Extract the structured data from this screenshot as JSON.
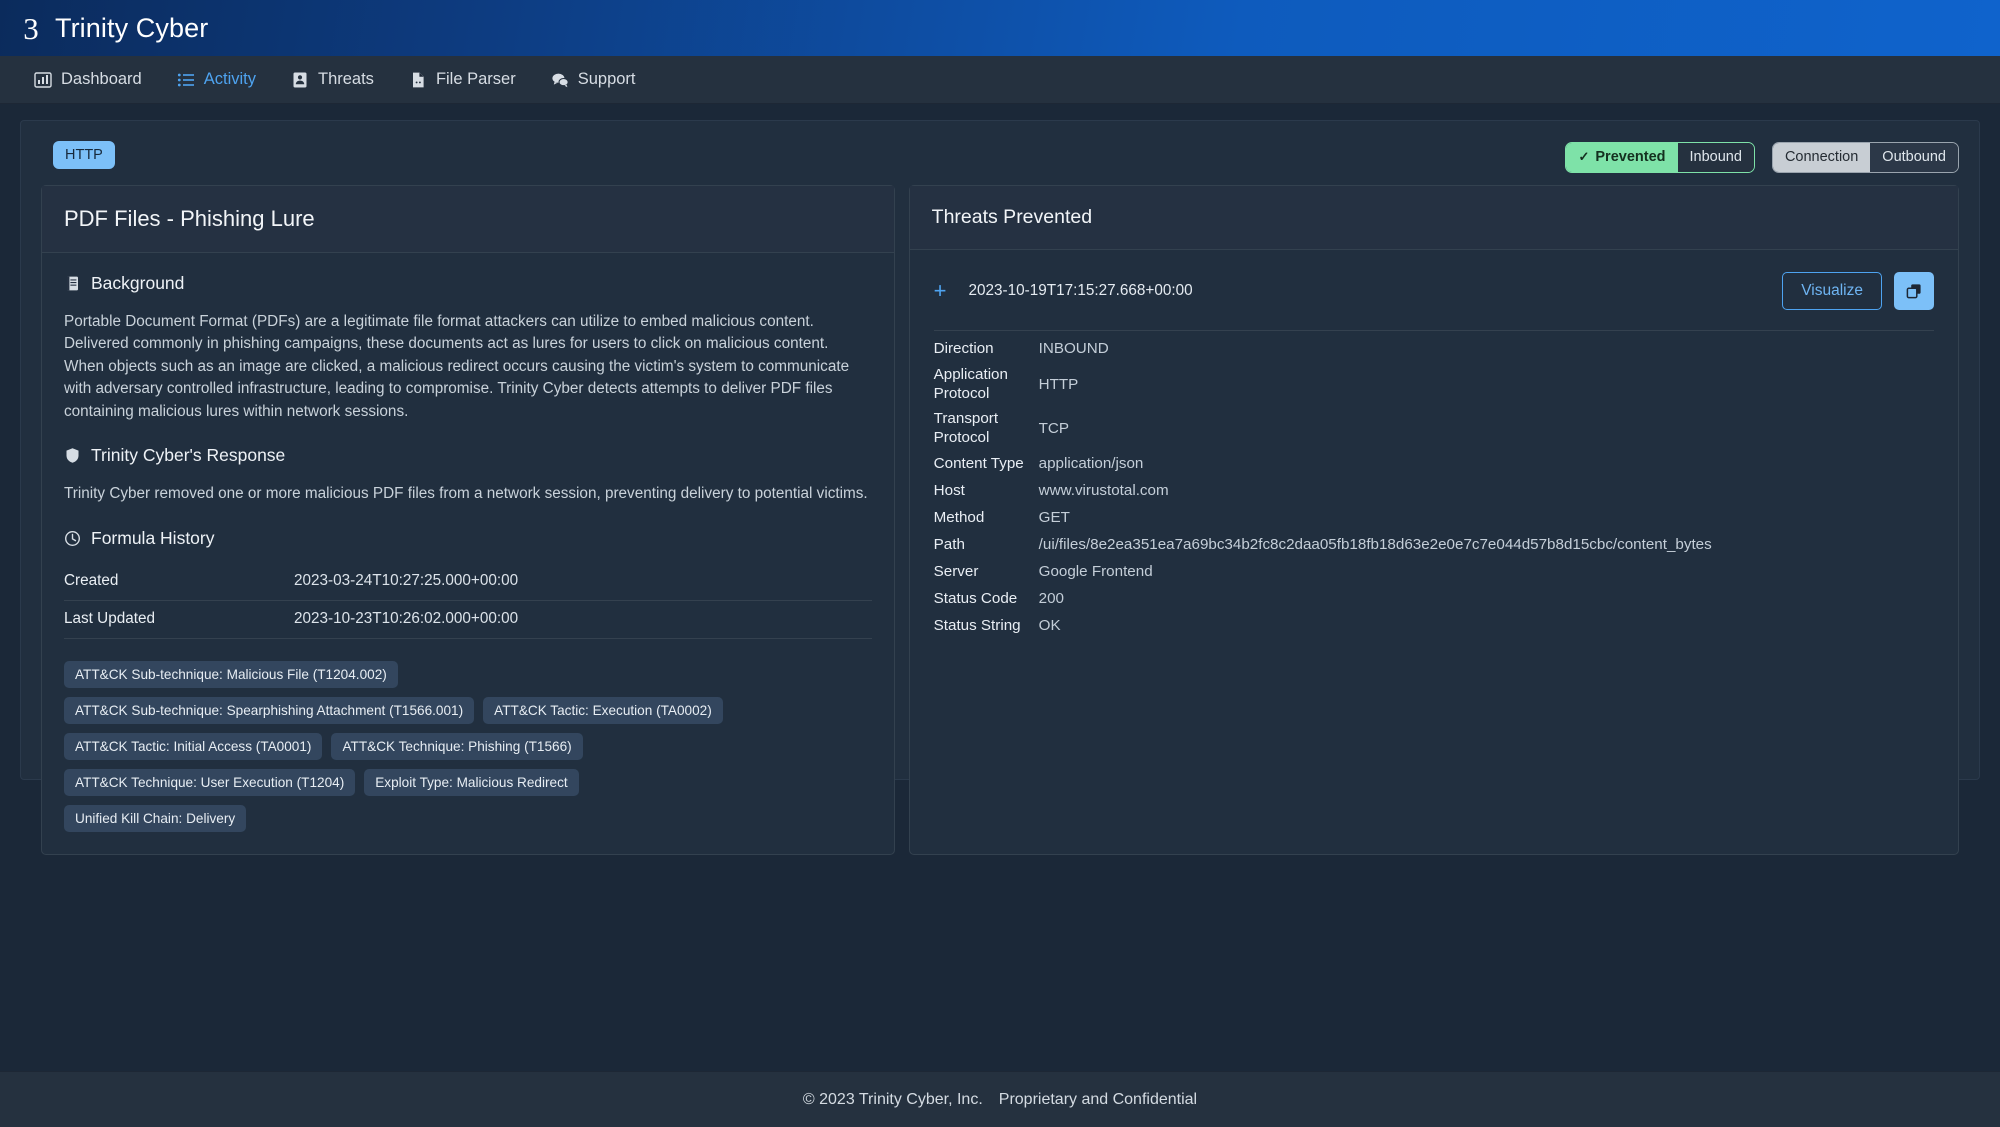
{
  "brand": {
    "logo_icon": "trinity-cyber-logo",
    "logo_glyph": "3",
    "name": "Trinity Cyber"
  },
  "nav": {
    "items": [
      {
        "label": "Dashboard",
        "icon": "chart-bar-icon",
        "active": false
      },
      {
        "label": "Activity",
        "icon": "list-icon",
        "active": true
      },
      {
        "label": "Threats",
        "icon": "threat-id-icon",
        "active": false
      },
      {
        "label": "File Parser",
        "icon": "file-code-icon",
        "active": false
      },
      {
        "label": "Support",
        "icon": "chat-bubbles-icon",
        "active": false
      }
    ]
  },
  "toolbar": {
    "protocol_badge": "HTTP",
    "segment_status": {
      "selected_label": "Prevented",
      "selected_check_icon": "check-icon",
      "other_label": "Inbound"
    },
    "segment_direction": {
      "selected_label": "Connection",
      "other_label": "Outbound"
    }
  },
  "left_card": {
    "title": "PDF Files - Phishing Lure",
    "background": {
      "icon": "book-icon",
      "heading": "Background",
      "text": "Portable Document Format (PDFs) are a legitimate file format attackers can utilize to embed malicious content. Delivered commonly in phishing campaigns, these documents act as lures for users to click on malicious content. When objects such as an image are clicked, a malicious redirect occurs causing the victim's system to communicate with adversary controlled infrastructure, leading to compromise. Trinity Cyber detects attempts to deliver PDF files containing malicious lures within network sessions."
    },
    "response": {
      "icon": "shield-icon",
      "heading": "Trinity Cyber's Response",
      "text": "Trinity Cyber removed one or more malicious PDF files from a network session, preventing delivery to potential victims."
    },
    "formula_history": {
      "icon": "clock-icon",
      "heading": "Formula History",
      "rows": [
        {
          "key": "Created",
          "value": "2023-03-24T10:27:25.000+00:00"
        },
        {
          "key": "Last Updated",
          "value": "2023-10-23T10:26:02.000+00:00"
        }
      ]
    },
    "tags": [
      "ATT&CK Sub-technique: Malicious File (T1204.002)",
      "ATT&CK Sub-technique: Spearphishing Attachment (T1566.001)",
      "ATT&CK Tactic: Execution (TA0002)",
      "ATT&CK Tactic: Initial Access (TA0001)",
      "ATT&CK Technique: Phishing (T1566)",
      "ATT&CK Technique: User Execution (T1204)",
      "Exploit Type: Malicious Redirect",
      "Unified Kill Chain: Delivery"
    ]
  },
  "right_card": {
    "title": "Threats Prevented",
    "event": {
      "expand_icon": "plus-icon",
      "timestamp": "2023-10-19T17:15:27.668+00:00",
      "visualize_label": "Visualize",
      "copy_icon": "copy-icon"
    },
    "details": [
      {
        "key": "Direction",
        "value": "INBOUND"
      },
      {
        "key": "Application Protocol",
        "value": "HTTP"
      },
      {
        "key": "Transport Protocol",
        "value": "TCP"
      },
      {
        "key": "Content Type",
        "value": "application/json"
      },
      {
        "key": "Host",
        "value": "www.virustotal.com"
      },
      {
        "key": "Method",
        "value": "GET"
      },
      {
        "key": "Path",
        "value": "/ui/files/8e2ea351ea7a69bc34b2fc8c2daa05fb18fb18d63e2e0e7c7e044d57b8d15cbc/content_bytes"
      },
      {
        "key": "Server",
        "value": "Google Frontend"
      },
      {
        "key": "Status Code",
        "value": "200"
      },
      {
        "key": "Status String",
        "value": "OK"
      }
    ]
  },
  "footer": {
    "copyright": "© 2023 Trinity Cyber, Inc.",
    "confidentiality": "Proprietary and Confidential"
  },
  "colors": {
    "brand_blue": "#0e5bbd",
    "accent_blue": "#4ea3f0",
    "badge_blue": "#7cc0f8",
    "success_green": "#7ee2a8",
    "page_bg": "#1b2838",
    "panel_bg": "#212f3f",
    "nav_bg": "#25313f"
  }
}
